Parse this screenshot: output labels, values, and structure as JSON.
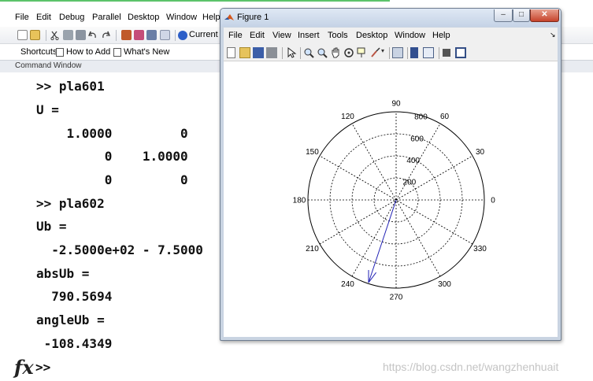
{
  "matlab": {
    "menu": [
      "File",
      "Edit",
      "Debug",
      "Parallel",
      "Desktop",
      "Window",
      "Help"
    ],
    "current_folder_label": "Current F",
    "shortcuts_label": "Shortcuts",
    "how_to_add_label": "How to Add",
    "whats_new_label": "What's New",
    "command_window_title": "Command Window",
    "lines": [
      ">> pla601",
      "U =",
      "    1.0000         0",
      "         0    1.0000",
      "         0         0",
      ">> pla602",
      "Ub =",
      "  -2.5000e+02 - 7.5000",
      "absUb =",
      "  790.5694",
      "angleUb =",
      " -108.4349"
    ],
    "fx_symbol": "fx",
    "prompt": ">>",
    "watermark": "https://blog.csdn.net/wangzhenhuait"
  },
  "figure": {
    "title": "Figure 1",
    "menu": [
      "File",
      "Edit",
      "View",
      "Insert",
      "Tools",
      "Desktop",
      "Window",
      "Help"
    ],
    "menu_arrow": "↘"
  },
  "chart_data": {
    "type": "polar",
    "radial_ticks": [
      200,
      400,
      600,
      800
    ],
    "rmax": 800,
    "angle_ticks": [
      0,
      30,
      60,
      90,
      120,
      150,
      180,
      210,
      240,
      270,
      300,
      330
    ],
    "grid": true,
    "series": [
      {
        "type": "compass-arrow",
        "r": 790.5694,
        "theta_deg": -108.4349,
        "color": "#1f1fb4"
      }
    ]
  }
}
